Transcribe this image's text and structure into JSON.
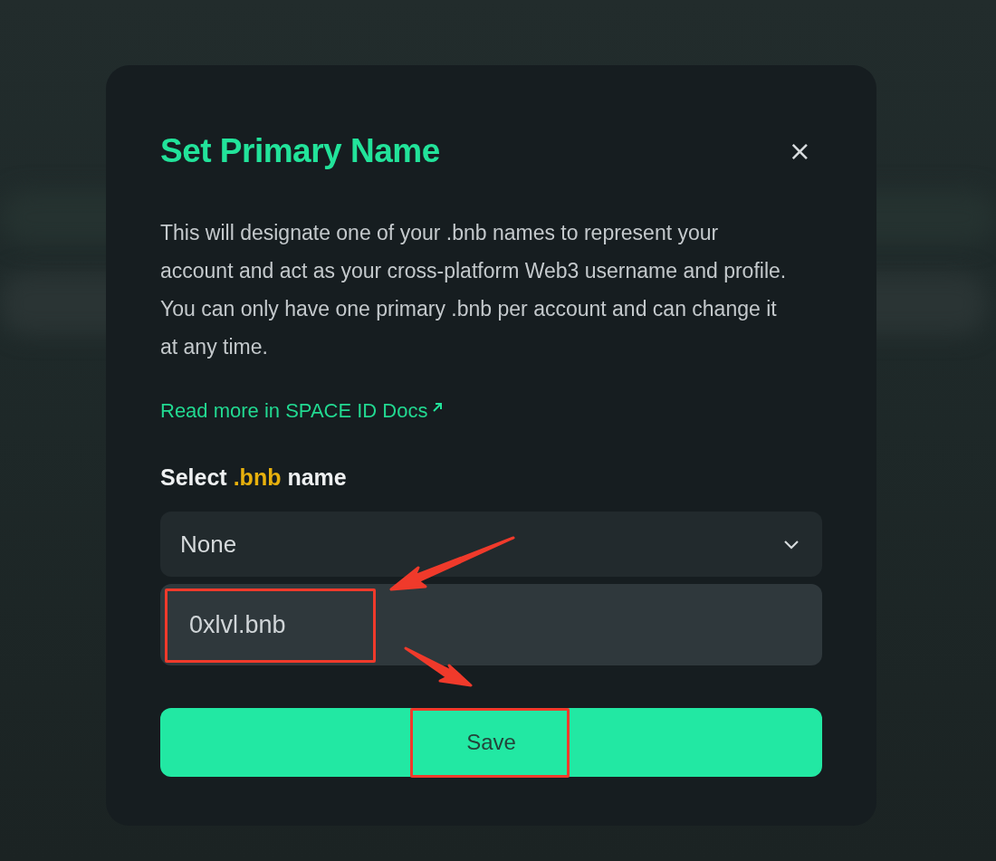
{
  "dialog": {
    "title": "Set Primary Name",
    "close": "×",
    "description": "This will designate one of your .bnb names to represent your account and act as your cross-platform Web3 username and profile. You can only have one primary .bnb per account and can change it at any time.",
    "link": "Read more in SPACE ID Docs",
    "select_label": {
      "prefix": "Select",
      "highlight": ".bnb",
      "suffix": "name"
    },
    "select": {
      "value": "None",
      "expanded": true
    },
    "options": [
      {
        "label": "0xlvl.bnb",
        "selected": false
      }
    ],
    "save_button": "Save"
  }
}
